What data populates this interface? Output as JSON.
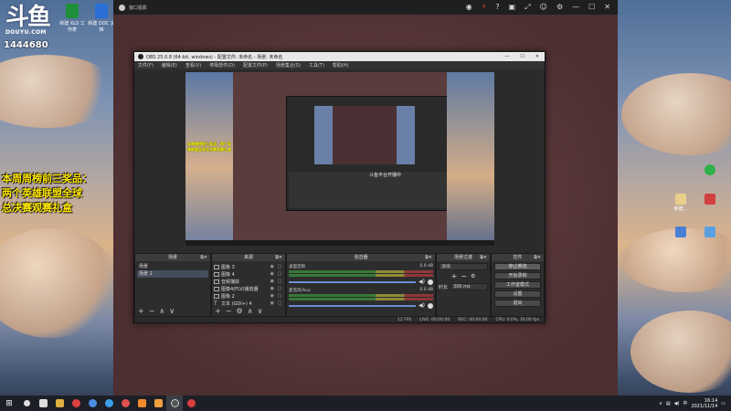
{
  "desktop": {
    "logo_text": "斗鱼",
    "logo_domain": "DOUYU.COM",
    "room_number": "1444680",
    "icons_left": [
      {
        "label": "新建 XLS 工作表",
        "color": "#1f8f3a"
      },
      {
        "label": "新建 DOC 文档",
        "color": "#2a6fd6"
      }
    ],
    "promo_lines": [
      "本周周榜前三奖品：",
      "两个英雄联盟全球",
      "总决赛观赛礼盒"
    ],
    "icons_right": [
      {
        "label": "",
        "color": "#2fb24a"
      },
      {
        "label": "新建...",
        "color": "#e8d08a"
      },
      {
        "label": "",
        "color": "#d24040"
      },
      {
        "label": "",
        "color": "#4a7fd6"
      },
      {
        "label": "",
        "color": "#5aa0e0"
      }
    ]
  },
  "projector": {
    "title": "窗口投影",
    "controls": [
      "◉",
      "⚡",
      "?",
      "▣",
      "⤢",
      "☺",
      "⚙",
      "—",
      "☐",
      "✕"
    ]
  },
  "obs": {
    "title": "OBS 25.0.8 (64-bit, windows) - 配置文件: 未命名 - 场景: 未命名",
    "window_controls": [
      "—",
      "☐",
      "✕"
    ],
    "menu": [
      "文件(F)",
      "编辑(E)",
      "查看(V)",
      "停靠部件(D)",
      "配置文件(P)",
      "场景集合(S)",
      "工具(T)",
      "帮助(H)"
    ],
    "preview_inner_label": "斗鱼平台开播中",
    "preview_promo": "本周周榜前三奖品：两个英雄联盟全球总决赛观赛礼盒",
    "scenes": {
      "title": "场景",
      "items": [
        "场景",
        "场景 2"
      ],
      "selected_index": 1
    },
    "sources": {
      "title": "来源",
      "items": [
        "图像 3",
        "图像 4",
        "音频捕获",
        "图像4(FLV)播放器",
        "图像 2",
        "文本 (GDI+) 4"
      ]
    },
    "mixer": {
      "title": "混音器",
      "tracks": [
        {
          "name": "桌面音频",
          "db": "0.0 dB"
        },
        {
          "name": "麦克风/Aux",
          "db": "0.0 dB"
        }
      ]
    },
    "transitions": {
      "title": "场景过渡",
      "type": "淡出",
      "duration_label": "时长",
      "duration": "300 ms"
    },
    "controls": {
      "title": "控件",
      "buttons": [
        "停止推流",
        "开始录制",
        "工作室模式",
        "设置",
        "退出"
      ]
    },
    "status": {
      "live_label": "LIVE: 00:00:00",
      "rec_label": "REC: 00:00:00",
      "cpu_label": "CPU: 0.0%, 30.00 fps",
      "bitrate": "12 FPS"
    },
    "dock_footer_icons": [
      "+",
      "−",
      "∧",
      "∨"
    ]
  },
  "taskbar": {
    "start_icon": "windows-icon",
    "apps": [
      {
        "name": "search",
        "color": "#ddd"
      },
      {
        "name": "taskview",
        "color": "#ddd"
      },
      {
        "name": "explorer",
        "color": "#e0b040"
      },
      {
        "name": "douyu",
        "color": "#e04040"
      },
      {
        "name": "chrome",
        "color": "#4a90e2"
      },
      {
        "name": "edge",
        "color": "#3ba0e8"
      },
      {
        "name": "weibo",
        "color": "#e05050"
      },
      {
        "name": "app-orange",
        "color": "#f08a2a"
      },
      {
        "name": "app-orange2",
        "color": "#f0a040"
      },
      {
        "name": "obs",
        "color": "#555"
      },
      {
        "name": "app-red",
        "color": "#d84040"
      }
    ],
    "time": "16:14",
    "date": "2021/11/14"
  }
}
